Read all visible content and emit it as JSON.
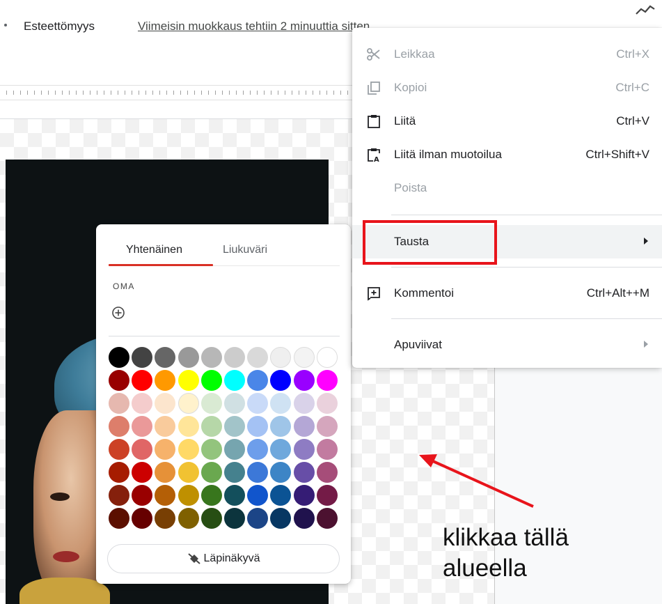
{
  "topbar": {
    "accessibility_menu": "Esteettömyys",
    "last_edit": "Viimeisin muokkaus tehtiin 2 minuuttia sitten"
  },
  "context_menu": {
    "items": [
      {
        "label": "Leikkaa",
        "shortcut": "Ctrl+X",
        "icon": "scissors-icon",
        "disabled": true
      },
      {
        "label": "Kopioi",
        "shortcut": "Ctrl+C",
        "icon": "copy-icon",
        "disabled": true
      },
      {
        "label": "Liitä",
        "shortcut": "Ctrl+V",
        "icon": "clipboard-icon",
        "disabled": false
      },
      {
        "label": "Liitä ilman muotoilua",
        "shortcut": "Ctrl+Shift+V",
        "icon": "clipboard-text-icon",
        "disabled": false
      },
      {
        "label": "Poista",
        "shortcut": "",
        "icon": "",
        "disabled": true
      },
      {
        "label": "Tausta",
        "shortcut": "",
        "icon": "",
        "submenu": true,
        "highlighted": true
      },
      {
        "label": "Kommentoi",
        "shortcut": "Ctrl+Alt++M",
        "icon": "add-comment-icon",
        "disabled": false
      },
      {
        "label": "Apuviivat",
        "shortcut": "",
        "icon": "",
        "submenu": true
      }
    ]
  },
  "color_picker": {
    "tab_solid": "Yhtenäinen",
    "tab_gradient": "Liukuväri",
    "custom_label": "OMA",
    "transparent_label": "Läpinäkyvä",
    "swatch_rows": [
      [
        "#000000",
        "#434343",
        "#666666",
        "#999999",
        "#b7b7b7",
        "#cccccc",
        "#d9d9d9",
        "#efefef",
        "#f3f3f3",
        "#ffffff"
      ],
      [
        "#980000",
        "#ff0000",
        "#ff9900",
        "#ffff00",
        "#00ff00",
        "#00ffff",
        "#4a86e8",
        "#0000ff",
        "#9900ff",
        "#ff00ff"
      ],
      [
        "#e6b8af",
        "#f4cccc",
        "#fce5cd",
        "#fff2cc",
        "#d9ead3",
        "#d0e0e3",
        "#c9daf8",
        "#cfe2f3",
        "#d9d2e9",
        "#ead1dc"
      ],
      [
        "#dd7e6b",
        "#ea9999",
        "#f9cb9c",
        "#ffe599",
        "#b6d7a8",
        "#a2c4c9",
        "#a4c2f4",
        "#9fc5e8",
        "#b4a7d6",
        "#d5a6bd"
      ],
      [
        "#cc4125",
        "#e06666",
        "#f6b26b",
        "#ffd966",
        "#93c47d",
        "#76a5af",
        "#6d9eeb",
        "#6fa8dc",
        "#8e7cc3",
        "#c27ba0"
      ],
      [
        "#a61c00",
        "#cc0000",
        "#e69138",
        "#f1c232",
        "#6aa84f",
        "#45818e",
        "#3c78d8",
        "#3d85c6",
        "#674ea7",
        "#a64d79"
      ],
      [
        "#85200c",
        "#990000",
        "#b45f06",
        "#bf9000",
        "#38761d",
        "#134f5c",
        "#1155cc",
        "#0b5394",
        "#351c75",
        "#741b47"
      ],
      [
        "#5b0f00",
        "#660000",
        "#783f04",
        "#7f6000",
        "#274e13",
        "#0c343d",
        "#1c4587",
        "#073763",
        "#20124d",
        "#4c1130"
      ]
    ]
  },
  "annotation": {
    "line1": "klikkaa tällä",
    "line2": "alueella",
    "box_color": "#e8141b",
    "arrow_color": "#e8141b"
  }
}
